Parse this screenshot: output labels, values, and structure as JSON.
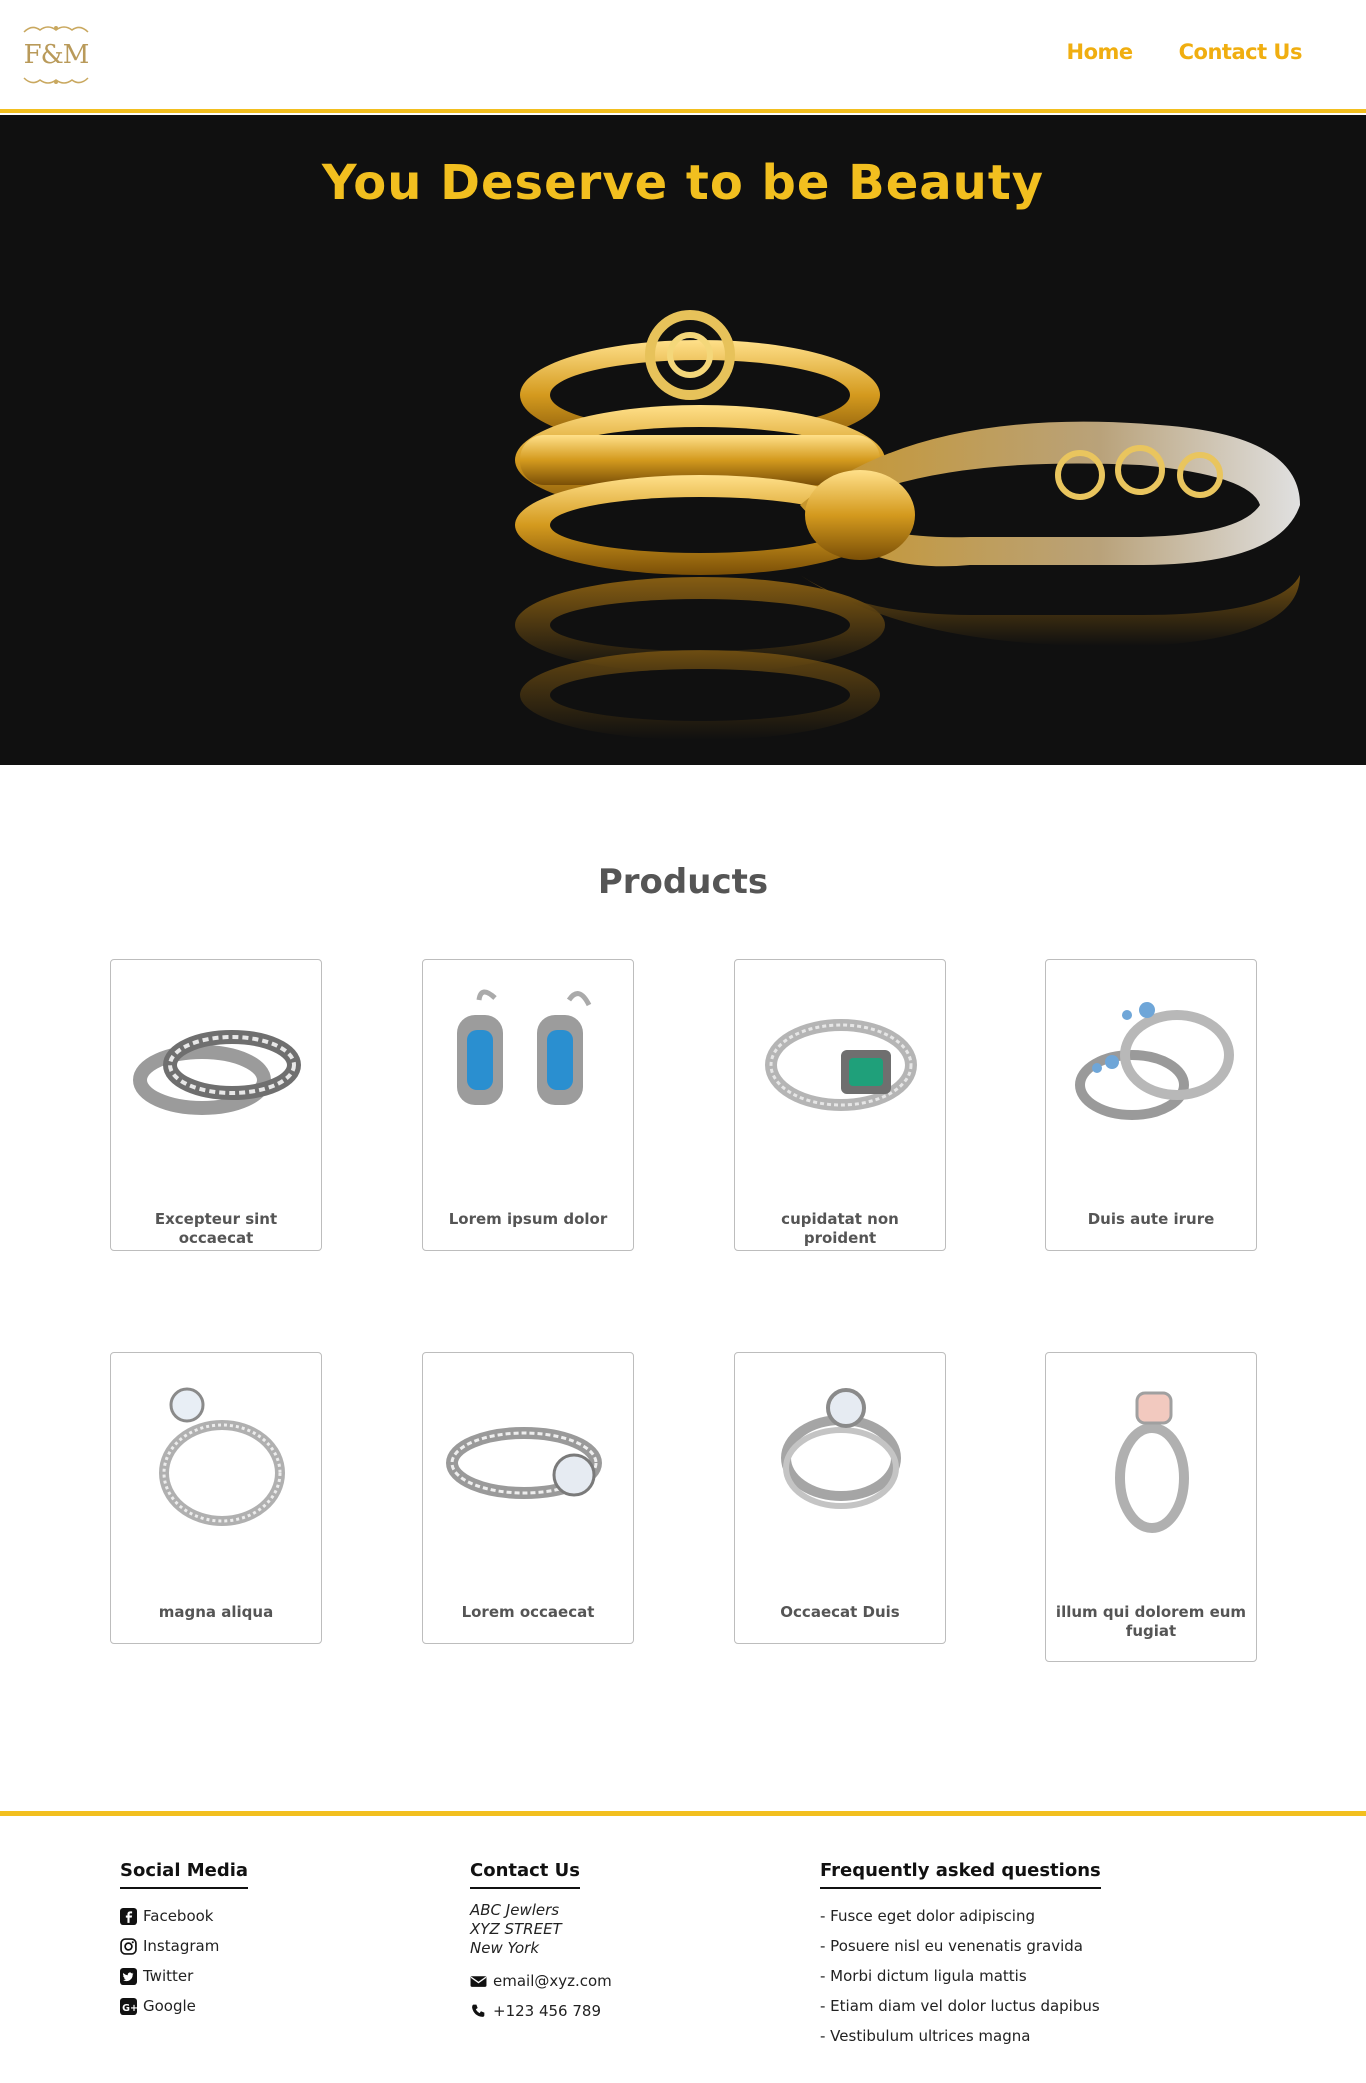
{
  "header": {
    "logo_text": "F&M",
    "nav": {
      "home": "Home",
      "contact": "Contact Us"
    }
  },
  "hero": {
    "title": "You Deserve to be Beauty"
  },
  "products": {
    "title": "Products",
    "items": [
      {
        "caption": "Excepteur sint occaecat",
        "image": "stacked-silver-bands"
      },
      {
        "caption": "Lorem ipsum dolor",
        "image": "blue-topaz-earrings"
      },
      {
        "caption": "cupidatat non proident",
        "image": "emerald-ring"
      },
      {
        "caption": "Duis aute irure",
        "image": "blue-stone-twin-rings"
      },
      {
        "caption": "magna aliqua",
        "image": "solitaire-ring"
      },
      {
        "caption": "Lorem occaecat",
        "image": "diamond-band-ring"
      },
      {
        "caption": "Occaecat Duis",
        "image": "halo-ring"
      },
      {
        "caption": "illum qui dolorem eum fugiat",
        "image": "pink-stone-ring"
      }
    ]
  },
  "footer": {
    "social": {
      "title": "Social Media",
      "links": [
        "Facebook",
        "Instagram",
        "Twitter",
        "Google"
      ]
    },
    "contact": {
      "title": "Contact Us",
      "address": [
        "ABC Jewlers",
        "XYZ STREET",
        "New York"
      ],
      "email": "email@xyz.com",
      "phone": "+123 456 789"
    },
    "faq": {
      "title": "Frequently asked questions",
      "items": [
        "- Fusce eget dolor adipiscing",
        "- Posuere nisl eu venenatis gravida",
        "- Morbi dictum ligula mattis",
        "- Etiam diam vel dolor luctus dapibus",
        "- Vestibulum ultrices magna"
      ]
    }
  },
  "colors": {
    "accent": "#f2bf1f",
    "nav": "#f0ae10",
    "hero_bg": "#101010"
  }
}
